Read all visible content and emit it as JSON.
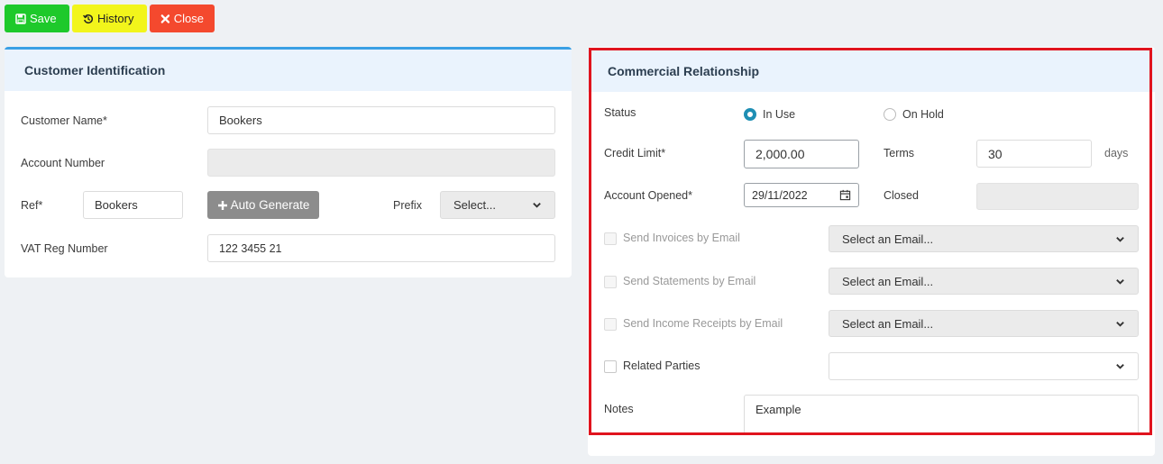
{
  "toolbar": {
    "save_label": "Save",
    "history_label": "History",
    "close_label": "Close"
  },
  "customer_identification": {
    "title": "Customer Identification",
    "customer_name_label": "Customer Name*",
    "customer_name_value": "Bookers",
    "account_number_label": "Account Number",
    "account_number_value": "",
    "ref_label": "Ref*",
    "ref_value": "Bookers",
    "auto_generate_label": "Auto Generate",
    "prefix_label": "Prefix",
    "prefix_selected": "Select...",
    "vat_label": "VAT Reg Number",
    "vat_value": "122 3455 21"
  },
  "commercial_relationship": {
    "title": "Commercial Relationship",
    "status_label": "Status",
    "status_options": [
      "In Use",
      "On Hold"
    ],
    "status_selected": "In Use",
    "credit_limit_label": "Credit Limit*",
    "credit_limit_value": "2,000.00",
    "terms_label": "Terms",
    "terms_value": "30",
    "terms_unit": "days",
    "account_opened_label": "Account Opened*",
    "account_opened_value": "29/11/2022",
    "closed_label": "Closed",
    "closed_value": "",
    "send_invoices_label": "Send Invoices by Email",
    "send_invoices_select": "Select an Email...",
    "send_statements_label": "Send Statements by Email",
    "send_statements_select": "Select an Email...",
    "send_receipts_label": "Send Income Receipts by Email",
    "send_receipts_select": "Select an Email...",
    "related_parties_label": "Related Parties",
    "related_parties_select": "",
    "notes_label": "Notes",
    "notes_value": "Example"
  },
  "colors": {
    "save": "#1ec92b",
    "history": "#f2f51b",
    "close": "#f4492e",
    "highlight_border": "#e0141e",
    "panel_accent": "#3aa0e4",
    "radio_on": "#1f8fb4"
  },
  "icons": {
    "save": "floppy-disk-icon",
    "history": "history-icon",
    "close": "close-icon",
    "auto_generate": "plus-icon",
    "calendar": "calendar-icon",
    "dropdown": "chevron-down-icon"
  }
}
